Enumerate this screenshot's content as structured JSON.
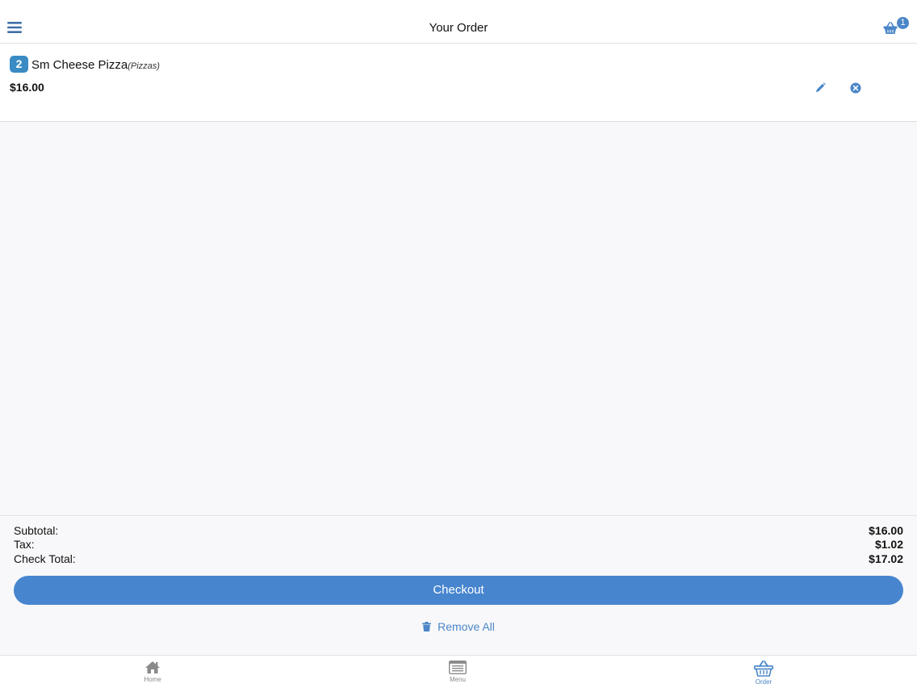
{
  "header": {
    "title": "Your Order",
    "menu_icon": "hamburger-icon",
    "cart_icon": "basket-icon",
    "cart_count": "1"
  },
  "order": {
    "items": [
      {
        "quantity": "2",
        "name": "Sm Cheese Pizza",
        "category": "(Pizzas)",
        "price": "$16.00",
        "edit_icon": "pencil-icon",
        "remove_icon": "close-circle-icon"
      }
    ]
  },
  "summary": {
    "subtotal_label": "Subtotal:",
    "subtotal_value": "$16.00",
    "tax_label": "Tax:",
    "tax_value": "$1.02",
    "total_label": "Check Total:",
    "total_value": "$17.02"
  },
  "actions": {
    "checkout_label": "Checkout",
    "remove_all_label": "Remove All",
    "remove_all_icon": "trash-icon"
  },
  "tabbar": {
    "tabs": [
      {
        "label": "Home",
        "icon": "home-icon",
        "active": false
      },
      {
        "label": "Menu",
        "icon": "menu-list-icon",
        "active": false
      },
      {
        "label": "Order",
        "icon": "basket-icon",
        "active": true
      }
    ]
  },
  "colors": {
    "accent": "#4785cf",
    "badge": "#3a8bc4",
    "background": "#f8f8fa",
    "inactive_tab": "#888888"
  }
}
